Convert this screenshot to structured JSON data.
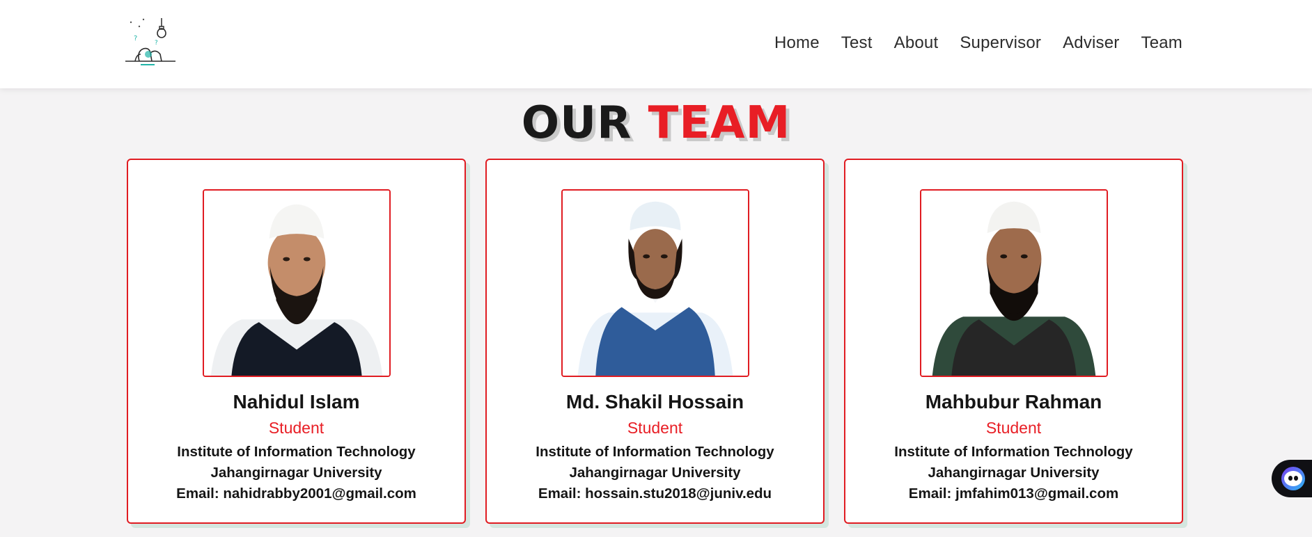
{
  "header": {
    "logo_icon": "lightbulb-thinking-person-logo",
    "nav": [
      {
        "label": "Home"
      },
      {
        "label": "Test"
      },
      {
        "label": "About"
      },
      {
        "label": "Supervisor"
      },
      {
        "label": "Adviser"
      },
      {
        "label": "Team"
      }
    ]
  },
  "section": {
    "title_part1": "OUR",
    "title_part2": "TEAM"
  },
  "members": [
    {
      "name": "Nahidul Islam",
      "role": "Student",
      "institute": "Institute of Information Technology",
      "university": "Jahangirnagar University",
      "email": "Email: nahidrabby2001@gmail.com",
      "vest_color": "#141a26",
      "shirt_color": "#eef0f2"
    },
    {
      "name": "Md. Shakil Hossain",
      "role": "Student",
      "institute": "Institute of Information Technology",
      "university": "Jahangirnagar University",
      "email": "Email: hossain.stu2018@juniv.edu",
      "vest_color": "#2f5c9a",
      "shirt_color": "#e9f1f9"
    },
    {
      "name": "Mahbubur Rahman",
      "role": "Student",
      "institute": "Institute of Information Technology",
      "university": "Jahangirnagar University",
      "email": "Email: jmfahim013@gmail.com",
      "vest_color": "#262626",
      "shirt_color": "#2f4a3b"
    }
  ],
  "colors": {
    "accent": "#e81e25",
    "background": "#f4f3f4",
    "card_shadow": "#d4e6df"
  },
  "chat_widget": {
    "icon": "chat-bot-icon"
  }
}
